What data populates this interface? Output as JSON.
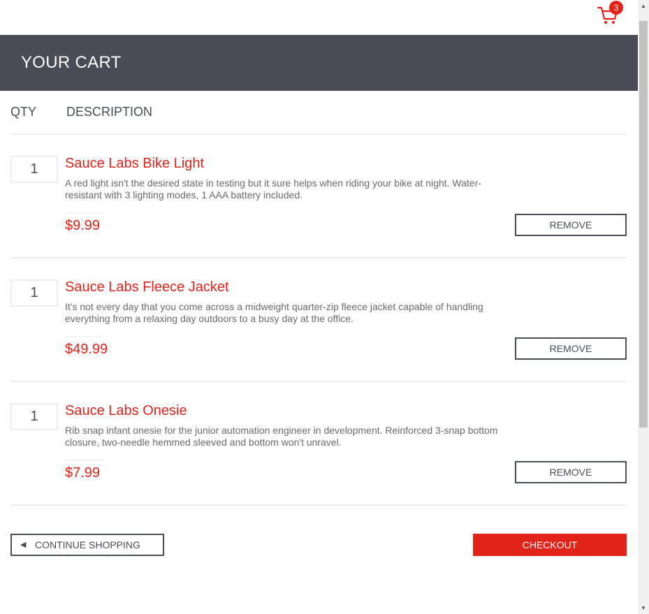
{
  "cart": {
    "icon": "shopping-cart-icon",
    "badge_count": "3"
  },
  "header": {
    "title": "YOUR CART"
  },
  "columns": {
    "qty": "QTY",
    "description": "DESCRIPTION"
  },
  "items": [
    {
      "qty": "1",
      "name": "Sauce Labs Bike Light",
      "description": "A red light isn't the desired state in testing but it sure helps when riding your bike at night. Water-resistant with 3 lighting modes, 1 AAA battery included.",
      "price": "$9.99",
      "remove_label": "REMOVE"
    },
    {
      "qty": "1",
      "name": "Sauce Labs Fleece Jacket",
      "description": "It's not every day that you come across a midweight quarter-zip fleece jacket capable of handling everything from a relaxing day outdoors to a busy day at the office.",
      "price": "$49.99",
      "remove_label": "REMOVE"
    },
    {
      "qty": "1",
      "name": "Sauce Labs Onesie",
      "description": "Rib snap infant onesie for the junior automation engineer in development. Reinforced 3-snap bottom closure, two-needle hemmed sleeved and bottom won't unravel.",
      "price": "$7.99",
      "remove_label": "REMOVE"
    }
  ],
  "footer": {
    "continue_icon": "left-arrow-icon",
    "continue_label": "CONTINUE SHOPPING",
    "checkout_label": "CHECKOUT"
  },
  "colors": {
    "accent": "#e2231a",
    "header_bg": "#474c55",
    "text": "#484c55"
  }
}
